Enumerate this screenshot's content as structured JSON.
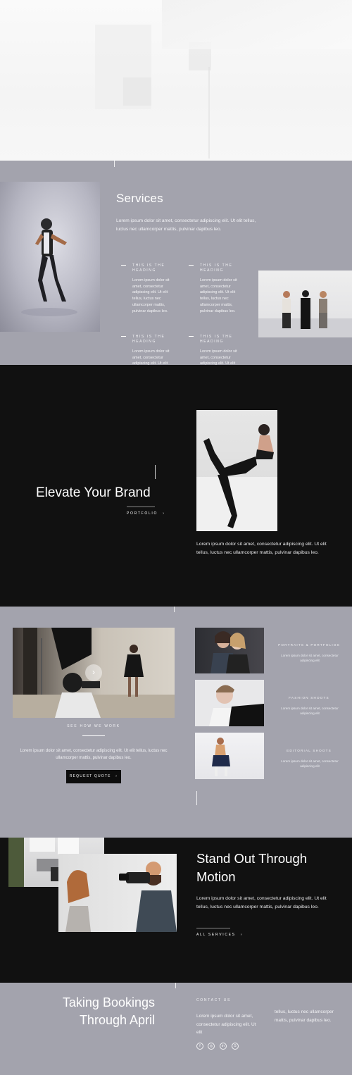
{
  "services": {
    "title": "Services",
    "intro": "Lorem ipsum dolor sit amet, consectetur adipiscing elit. Ut elit tellus, luctus nec ullamcorper mattis, pulvinar dapibus leo.",
    "items": [
      {
        "title": "THIS IS THE HEADING",
        "text": "Lorem ipsum dolor sit amet, consectetur adipiscing elit. Ut elit tellus, luctus nec ullamcorper mattis, pulvinar dapibus leo."
      },
      {
        "title": "THIS IS THE HEADING",
        "text": "Lorem ipsum dolor sit amet, consectetur adipiscing elit. Ut elit tellus, luctus nec ullamcorper mattis, pulvinar dapibus leo."
      },
      {
        "title": "THIS IS THE HEADING",
        "text": "Lorem ipsum dolor sit amet, consectetur adipiscing elit. Ut elit tellus, luctus nec ullamcorper mattis, pulvinar dapibus leo."
      },
      {
        "title": "THIS IS THE HEADING",
        "text": "Lorem ipsum dolor sit amet, consectetur adipiscing elit. Ut elit tellus, luctus nec ullamcorper mattis, pulvinar dapibus leo."
      }
    ]
  },
  "elevate": {
    "title": "Elevate Your Brand",
    "link_label": "PORTFOLIO",
    "text": "Lorem ipsum dolor sit amet, consectetur adipiscing elit. Ut elit tellus, luctus nec ullamcorper mattis, pulvinar dapibus leo."
  },
  "work": {
    "video_label": "SEE HOW WE WORK",
    "text": "Lorem ipsum dolor sit amet, consectetur adipiscing elit. Ut elit tellus, luctus nec ullamcorper mattis, pulvinar dapibus leo.",
    "button_label": "REQUEST QUOTE",
    "services": [
      {
        "title": "PORTRAITS & PORTFOLIOS",
        "text": "Lorem ipsum dolor sit amet, consectetur adipiscing elit"
      },
      {
        "title": "FASHION SHOOTS",
        "text": "Lorem ipsum dolor sit amet, consectetur adipiscing elit"
      },
      {
        "title": "EDITORIAL SHOOTS",
        "text": "Lorem ipsum dolor sit amet, consectetur adipiscing elit"
      }
    ]
  },
  "standout": {
    "title_line1": "Stand Out Through",
    "title_line2": "Motion",
    "text": "Lorem ipsum dolor sit amet, consectetur adipiscing elit. Ut elit tellus, luctus nec ullamcorper mattis, pulvinar dapibus leo.",
    "link_label": "ALL SERVICES"
  },
  "bookings": {
    "title_line1": "Taking Bookings",
    "title_line2": "Through April",
    "contact_label": "CONTACT US",
    "text_col1": "Lorem ipsum dolor sit amet, consectetur adipiscing elit. Ut elit",
    "text_col2": "tellus, luctus nec ullamcorper mattis, pulvinar dapibus leo.",
    "social_icons": [
      "facebook-icon",
      "instagram-icon",
      "linkedin-icon",
      "skype-icon"
    ],
    "social_glyphs": [
      "f",
      "◎",
      "in",
      "S"
    ]
  },
  "colors": {
    "gray": "#a3a3ad",
    "dark": "#111111",
    "button": "#0d0d0d"
  }
}
